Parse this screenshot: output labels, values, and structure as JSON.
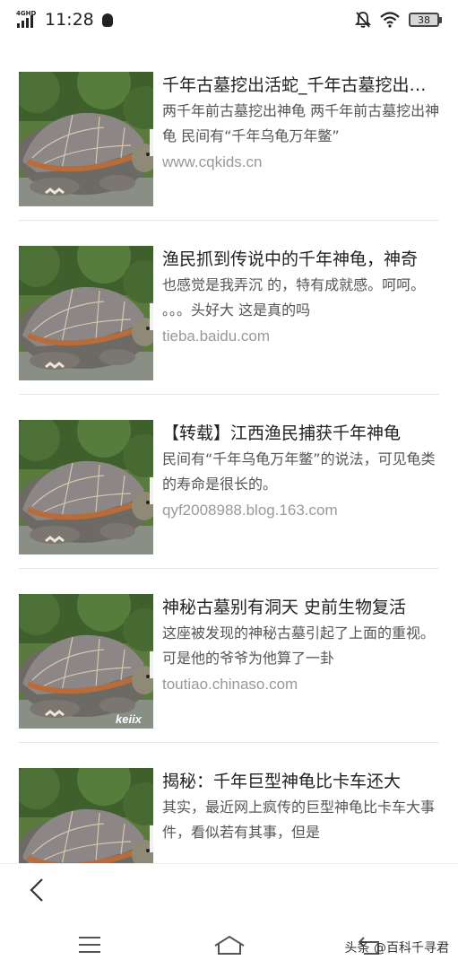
{
  "status_bar": {
    "network": "4GHD",
    "time": "11:28",
    "battery": "38",
    "icons": [
      "signal-icon",
      "qq-penguin-icon",
      "mute-icon",
      "wifi-icon",
      "battery-icon"
    ]
  },
  "results": [
    {
      "title": "千年古墓挖出活蛇_千年古墓挖出活蛇",
      "snippet": "两千年前古墓挖出神龟 两千年前古墓挖出神龟 民间有“千年乌龟万年鳖”",
      "url": "www.cqkids.cn"
    },
    {
      "title": "渔民抓到传说中的千年神龟，神奇",
      "snippet": "也感觉是我弄沉 的，特有成就感。呵呵。 。。。头好大 这是真的吗",
      "url": "tieba.baidu.com"
    },
    {
      "title": "【转载】江西渔民捕获千年神龟",
      "snippet": "民间有“千年乌龟万年鳖”的说法，可见龟类的寿命是很长的。",
      "url": "qyf2008988.blog.163.com"
    },
    {
      "title": "神秘古墓别有洞天 史前生物复活",
      "snippet": "这座被发现的神秘古墓引起了上面的重视。 可是他的爷爷为他算了一卦",
      "url": "toutiao.chinaso.com",
      "image_watermark": "keiix"
    },
    {
      "title": "揭秘：千年巨型神龟比卡车还大",
      "snippet": "其实，最近网上疯传的巨型神龟比卡车大事件，看似若有其事，但是",
      "url": ""
    }
  ],
  "bottom": {
    "back_icon": "chevron-left-icon",
    "nav_icons": [
      "menu-icon",
      "home-icon",
      "return-icon"
    ],
    "watermark": "头条 @百科千寻君"
  }
}
